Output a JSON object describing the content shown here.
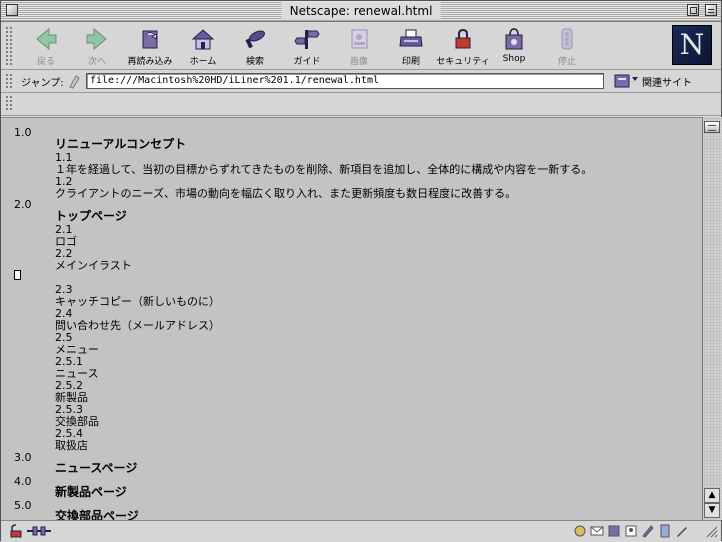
{
  "window": {
    "title": "Netscape: renewal.html"
  },
  "toolbar": {
    "buttons": [
      {
        "label": "戻る",
        "icon": "back-arrow-icon",
        "disabled": true
      },
      {
        "label": "次へ",
        "icon": "forward-arrow-icon",
        "disabled": true
      },
      {
        "label": "再読み込み",
        "icon": "reload-icon",
        "disabled": false
      },
      {
        "label": "ホーム",
        "icon": "home-icon",
        "disabled": false
      },
      {
        "label": "検索",
        "icon": "search-icon",
        "disabled": false
      },
      {
        "label": "ガイド",
        "icon": "guide-icon",
        "disabled": false
      },
      {
        "label": "画像",
        "icon": "images-icon",
        "disabled": true
      },
      {
        "label": "印刷",
        "icon": "print-icon",
        "disabled": false
      },
      {
        "label": "セキュリティ",
        "icon": "security-lock-icon",
        "disabled": false
      },
      {
        "label": "Shop",
        "icon": "shop-bag-icon",
        "disabled": false
      },
      {
        "label": "停止",
        "icon": "stop-icon",
        "disabled": true
      }
    ],
    "logo_letter": "N"
  },
  "location": {
    "label": "ジャンプ:",
    "url": "file:///Macintosh%20HD/iLiner%201.1/renewal.html",
    "related_label": "関連サイト"
  },
  "content": {
    "sections": [
      {
        "num": "1.0",
        "heading": "リニューアルコンセプト"
      },
      {
        "num": "1.1",
        "text": "１年を経過して、当初の目標からずれてきたものを削除、新項目を追加し、全体的に構成や内容を一新する。"
      },
      {
        "num": "1.2",
        "text": "クライアントのニーズ、市場の動向を幅広く取り入れ、また更新頻度も数日程度に改善する。"
      },
      {
        "num": "2.0",
        "heading": "トップページ"
      },
      {
        "num": "2.1",
        "text": "ロゴ"
      },
      {
        "num": "2.2",
        "text": "メインイラスト"
      },
      {
        "num": "2.3",
        "text": "キャッチコピー（新しいものに）"
      },
      {
        "num": "2.4",
        "text": "問い合わせ先（メールアドレス）"
      },
      {
        "num": "2.5",
        "text": "メニュー"
      },
      {
        "num": "2.5.1",
        "text": "ニュース"
      },
      {
        "num": "2.5.2",
        "text": "新製品"
      },
      {
        "num": "2.5.3",
        "text": "交換部品"
      },
      {
        "num": "2.5.4",
        "text": "取扱店"
      },
      {
        "num": "3.0",
        "heading": "ニュースページ"
      },
      {
        "num": "4.0",
        "heading": "新製品ページ"
      },
      {
        "num": "5.0",
        "heading": "交換部品ページ"
      }
    ]
  },
  "colors": {
    "content_bg": "#c3c3c3",
    "chrome_bg": "#d6d6d6",
    "logo_bg": "#0b1533"
  }
}
